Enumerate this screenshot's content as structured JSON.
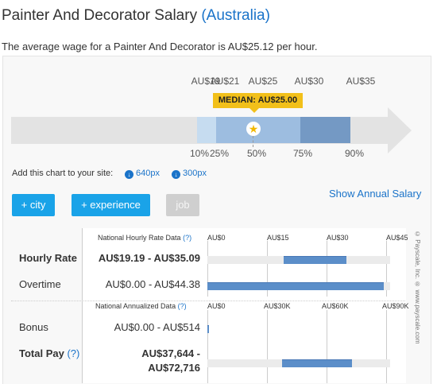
{
  "header": {
    "title": "Painter And Decorator Salary",
    "country": "(Australia)",
    "average_text": "The average wage for a Painter And Decorator is AU$25.12 per hour."
  },
  "range_chart": {
    "top_labels": [
      "AU$19",
      "AU$21",
      "AU$25",
      "AU$30",
      "AU$35"
    ],
    "percentile_labels": [
      "10%",
      "25%",
      "50%",
      "75%",
      "90%"
    ],
    "median_label": "MEDIAN: AU$25.00",
    "colors": {
      "arrow": "#e3e3e3",
      "outer": "#c6dcf0",
      "inner": "#9dbde0",
      "upper": "#7499c4",
      "median": "#f2c01a"
    }
  },
  "embed": {
    "label": "Add this chart to your site:",
    "size_small": "640px",
    "size_large": "300px"
  },
  "show_annual": "Show Annual Salary",
  "filters": {
    "city": "+ city",
    "experience": "+ experience",
    "job": "job"
  },
  "hourly_section": {
    "header": "National Hourly Rate Data",
    "help": "(?)",
    "axis": [
      "AU$0",
      "AU$15",
      "AU$30",
      "AU$45"
    ],
    "rows": [
      {
        "label": "Hourly Rate",
        "value": "AU$19.19 - AU$35.09",
        "range": [
          19.19,
          35.09
        ]
      },
      {
        "label": "Overtime",
        "value": "AU$0.00 - AU$44.38",
        "range": [
          0,
          44.38
        ]
      }
    ]
  },
  "annual_section": {
    "header": "National Annualized Data",
    "help": "(?)",
    "axis": [
      "AU$0",
      "AU$30K",
      "AU$60K",
      "AU$90K"
    ],
    "rows": [
      {
        "label": "Bonus",
        "value": "AU$0.00 - AU$514",
        "range": [
          0,
          514
        ]
      },
      {
        "label": "Total Pay",
        "help": "(?)",
        "value_line1": "AU$37,644 -",
        "value_line2": "AU$72,716",
        "range": [
          37644,
          72716
        ]
      }
    ]
  },
  "side_text": "© Payscale, Inc. ® www.payscale.com"
}
